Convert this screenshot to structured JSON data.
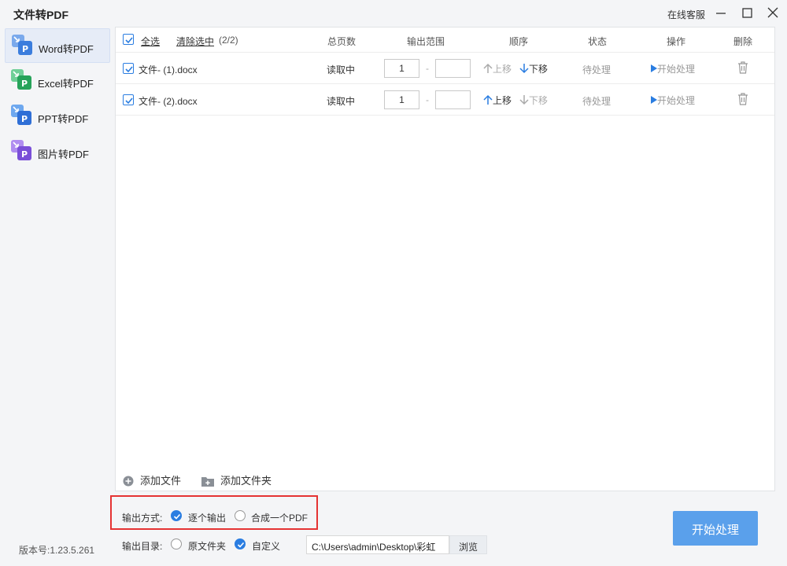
{
  "window": {
    "title": "文件转PDF",
    "support_label": "在线客服"
  },
  "sidebar": {
    "items": [
      {
        "label": "Word转PDF",
        "icon": "word-pdf-icon",
        "color": "#3b7ddd",
        "active": true
      },
      {
        "label": "Excel转PDF",
        "icon": "excel-pdf-icon",
        "color": "#27a35a",
        "active": false
      },
      {
        "label": "PPT转PDF",
        "icon": "ppt-pdf-icon",
        "color": "#2f6fd6",
        "active": false
      },
      {
        "label": "图片转PDF",
        "icon": "image-pdf-icon",
        "color": "#7a4fd8",
        "active": false
      }
    ],
    "version": "版本号:1.23.5.261"
  },
  "table": {
    "select_all": "全选",
    "clear_selection": "清除选中",
    "selection_count": "(2/2)",
    "headers": {
      "pages": "总页数",
      "range": "输出范围",
      "order": "顺序",
      "status": "状态",
      "action": "操作",
      "delete": "删除"
    },
    "rows": [
      {
        "name": "文件- (1).docx",
        "pages": "读取中",
        "range_from": "1",
        "range_to": "",
        "range_sep": "-",
        "move_up": "上移",
        "move_down": "下移",
        "status": "待处理",
        "action": "开始处理",
        "checked": true
      },
      {
        "name": "文件- (2).docx",
        "pages": "读取中",
        "range_from": "1",
        "range_to": "",
        "range_sep": "-",
        "move_up": "上移",
        "move_down": "下移",
        "status": "待处理",
        "action": "开始处理",
        "checked": true
      }
    ]
  },
  "footer": {
    "add_file": "添加文件",
    "add_folder": "添加文件夹"
  },
  "output": {
    "mode_label": "输出方式:",
    "mode_options": [
      "逐个输出",
      "合成一个PDF"
    ],
    "mode_selected": "逐个输出",
    "dir_label": "输出目录:",
    "dir_options": [
      "原文件夹",
      "自定义"
    ],
    "dir_selected": "自定义",
    "path": "C:\\Users\\admin\\Desktop\\彩虹",
    "browse": "浏览",
    "start": "开始处理"
  },
  "colors": {
    "accent": "#2a7de1",
    "start_button": "#5aa0eb",
    "highlight_border": "#e53333"
  }
}
